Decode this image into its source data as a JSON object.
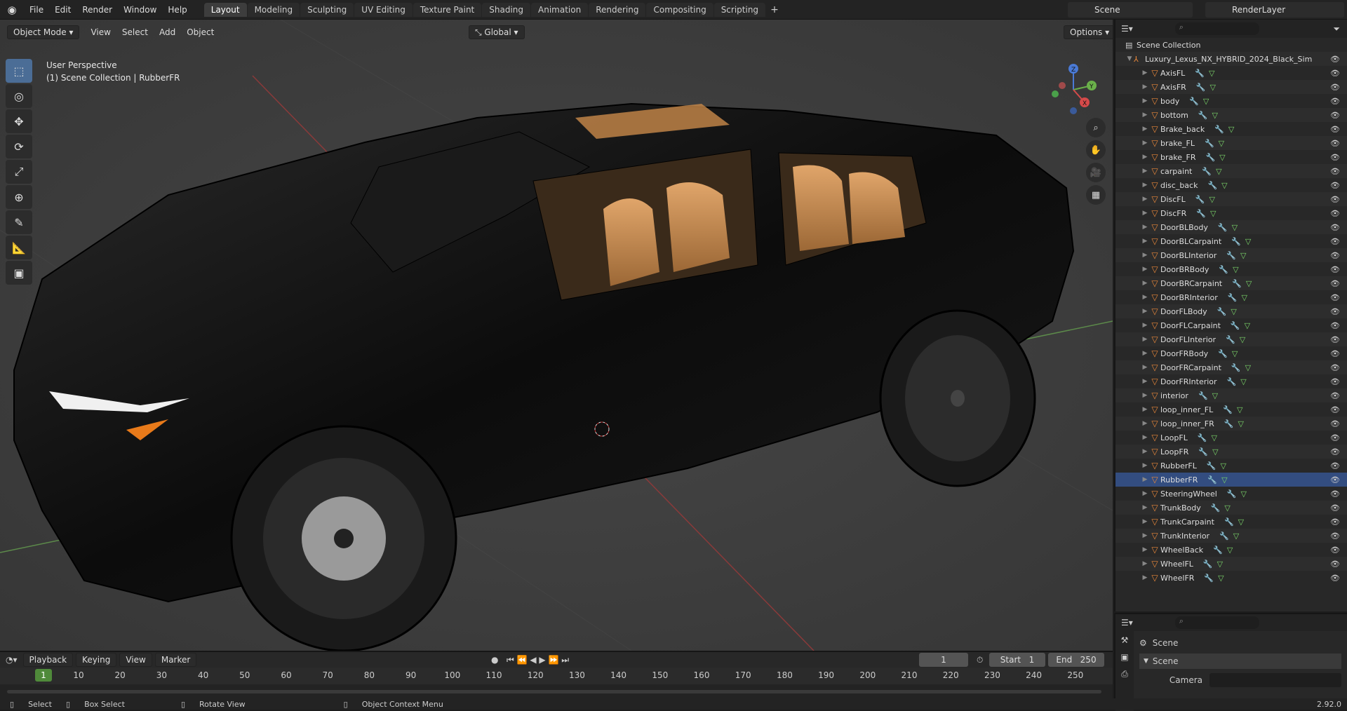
{
  "app": {
    "menus": [
      "File",
      "Edit",
      "Render",
      "Window",
      "Help"
    ]
  },
  "workspaces": [
    "Layout",
    "Modeling",
    "Sculpting",
    "UV Editing",
    "Texture Paint",
    "Shading",
    "Animation",
    "Rendering",
    "Compositing",
    "Scripting"
  ],
  "active_workspace": "Layout",
  "scene_name": "Scene",
  "render_layer": "RenderLayer",
  "viewport": {
    "mode": "Object Mode",
    "menus": [
      "View",
      "Select",
      "Add",
      "Object"
    ],
    "orientation": "Global",
    "options": "Options",
    "perspective_label": "User Perspective",
    "collection_label": "(1) Scene Collection | RubberFR"
  },
  "outliner": {
    "root": "Scene Collection",
    "collection": "Luxury_Lexus_NX_HYBRID_2024_Black_Sim",
    "items": [
      "AxisFL",
      "AxisFR",
      "body",
      "bottom",
      "Brake_back",
      "brake_FL",
      "brake_FR",
      "carpaint",
      "disc_back",
      "DiscFL",
      "DiscFR",
      "DoorBLBody",
      "DoorBLCarpaint",
      "DoorBLInterior",
      "DoorBRBody",
      "DoorBRCarpaint",
      "DoorBRInterior",
      "DoorFLBody",
      "DoorFLCarpaint",
      "DoorFLInterior",
      "DoorFRBody",
      "DoorFRCarpaint",
      "DoorFRInterior",
      "interior",
      "loop_inner_FL",
      "loop_inner_FR",
      "LoopFL",
      "LoopFR",
      "RubberFL",
      "RubberFR",
      "SteeringWheel",
      "TrunkBody",
      "TrunkCarpaint",
      "TrunkInterior",
      "WheelBack",
      "WheelFL",
      "WheelFR"
    ],
    "selected": "RubberFR"
  },
  "properties": {
    "scene_label": "Scene",
    "section": "Scene",
    "camera_label": "Camera"
  },
  "timeline": {
    "menus": [
      "Playback",
      "Keying",
      "View",
      "Marker"
    ],
    "current_frame": "1",
    "start_label": "Start",
    "start": "1",
    "end_label": "End",
    "end": "250",
    "ticks": [
      "1",
      "10",
      "20",
      "30",
      "40",
      "50",
      "60",
      "70",
      "80",
      "90",
      "100",
      "110",
      "120",
      "130",
      "140",
      "150",
      "160",
      "170",
      "180",
      "190",
      "200",
      "210",
      "220",
      "230",
      "240",
      "250"
    ]
  },
  "status": {
    "select": "Select",
    "box_select": "Box Select",
    "rotate": "Rotate View",
    "context": "Object Context Menu",
    "version": "2.92.0"
  }
}
